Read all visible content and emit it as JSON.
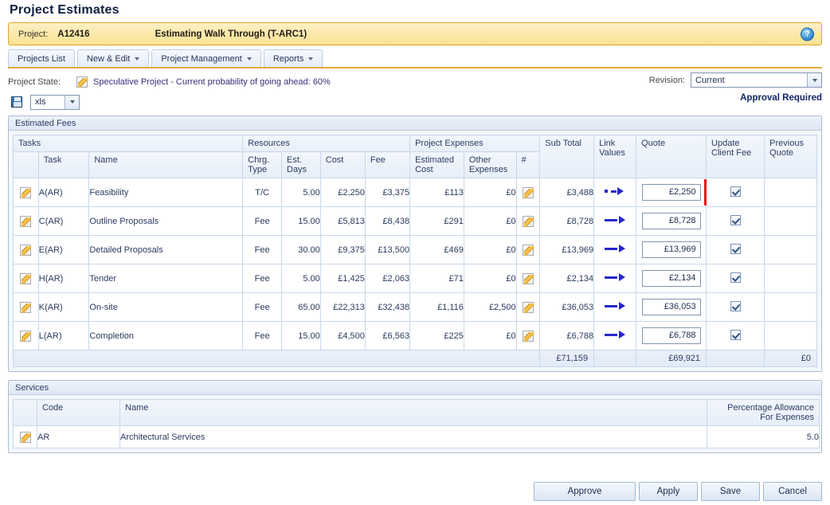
{
  "page_title": "Project Estimates",
  "project_bar": {
    "label": "Project:",
    "code": "A12416",
    "name": "Estimating Walk Through (T-ARC1)",
    "help_icon": "?"
  },
  "menu": [
    {
      "label": "Projects List",
      "has_caret": false
    },
    {
      "label": "New & Edit",
      "has_caret": true
    },
    {
      "label": "Project Management",
      "has_caret": true
    },
    {
      "label": "Reports",
      "has_caret": true
    }
  ],
  "state_row": {
    "label": "Project State:",
    "text": "Speculative Project - Current probability of going ahead: 60%",
    "revision_label": "Revision:",
    "revision_value": "Current"
  },
  "export_row": {
    "format_value": "xls",
    "approval_text": "Approval Required"
  },
  "estimated_fees": {
    "panel_title": "Estimated Fees",
    "group_headers": {
      "tasks": "Tasks",
      "resources": "Resources",
      "project_expenses": "Project Expenses"
    },
    "columns": {
      "task": "Task",
      "name": "Name",
      "chrg_type": "Chrg. Type",
      "est_days": "Est. Days",
      "cost": "Cost",
      "fee": "Fee",
      "estimated_cost": "Estimated Cost",
      "other_expenses": "Other Expenses",
      "hash": "#",
      "sub_total": "Sub Total",
      "link_values": "Link Values",
      "quote": "Quote",
      "update_client_fee": "Update Client Fee",
      "previous_quote": "Previous Quote"
    },
    "rows": [
      {
        "task": "A(AR)",
        "name": "Feasibility",
        "chrg_type": "T/C",
        "est_days": "5.00",
        "cost": "£2,250",
        "fee": "£3,375",
        "estimated_cost": "£113",
        "other_expenses": "£0",
        "sub_total": "£3,488",
        "link_state": "broken",
        "quote": "£2,250",
        "flagged": true,
        "update_client_fee": true,
        "previous_quote": ""
      },
      {
        "task": "C(AR)",
        "name": "Outline Proposals",
        "chrg_type": "Fee",
        "est_days": "15.00",
        "cost": "£5,813",
        "fee": "£8,438",
        "estimated_cost": "£291",
        "other_expenses": "£0",
        "sub_total": "£8,728",
        "link_state": "linked",
        "quote": "£8,728",
        "flagged": false,
        "update_client_fee": true,
        "previous_quote": ""
      },
      {
        "task": "E(AR)",
        "name": "Detailed Proposals",
        "chrg_type": "Fee",
        "est_days": "30.00",
        "cost": "£9,375",
        "fee": "£13,500",
        "estimated_cost": "£469",
        "other_expenses": "£0",
        "sub_total": "£13,969",
        "link_state": "linked",
        "quote": "£13,969",
        "flagged": false,
        "update_client_fee": true,
        "previous_quote": ""
      },
      {
        "task": "H(AR)",
        "name": "Tender",
        "chrg_type": "Fee",
        "est_days": "5.00",
        "cost": "£1,425",
        "fee": "£2,063",
        "estimated_cost": "£71",
        "other_expenses": "£0",
        "sub_total": "£2,134",
        "link_state": "linked",
        "quote": "£2,134",
        "flagged": false,
        "update_client_fee": true,
        "previous_quote": ""
      },
      {
        "task": "K(AR)",
        "name": "On-site",
        "chrg_type": "Fee",
        "est_days": "65.00",
        "cost": "£22,313",
        "fee": "£32,438",
        "estimated_cost": "£1,116",
        "other_expenses": "£2,500",
        "sub_total": "£36,053",
        "link_state": "linked",
        "quote": "£36,053",
        "flagged": false,
        "update_client_fee": true,
        "previous_quote": ""
      },
      {
        "task": "L(AR)",
        "name": "Completion",
        "chrg_type": "Fee",
        "est_days": "15.00",
        "cost": "£4,500",
        "fee": "£6,563",
        "estimated_cost": "£225",
        "other_expenses": "£0",
        "sub_total": "£6,788",
        "link_state": "linked",
        "quote": "£6,788",
        "flagged": false,
        "update_client_fee": true,
        "previous_quote": ""
      }
    ],
    "totals": {
      "sub_total": "£71,159",
      "quote": "£69,921",
      "previous_quote": "£0"
    }
  },
  "services": {
    "panel_title": "Services",
    "columns": {
      "code": "Code",
      "name": "Name",
      "percentage_allowance": "Percentage Allowance For Expenses"
    },
    "rows": [
      {
        "code": "AR",
        "name": "Architectural Services",
        "percentage_allowance": "5.0"
      }
    ]
  },
  "footer_buttons": {
    "approve": "Approve",
    "apply": "Apply",
    "save": "Save",
    "cancel": "Cancel"
  },
  "colors": {
    "project_bar_bg": "#fbe8a8",
    "project_bar_border": "#e0a52a",
    "menu_underline": "#e9a93b",
    "link_arrow": "#2626cc",
    "flag_red": "#e81010",
    "approval_text": "#13266b"
  }
}
